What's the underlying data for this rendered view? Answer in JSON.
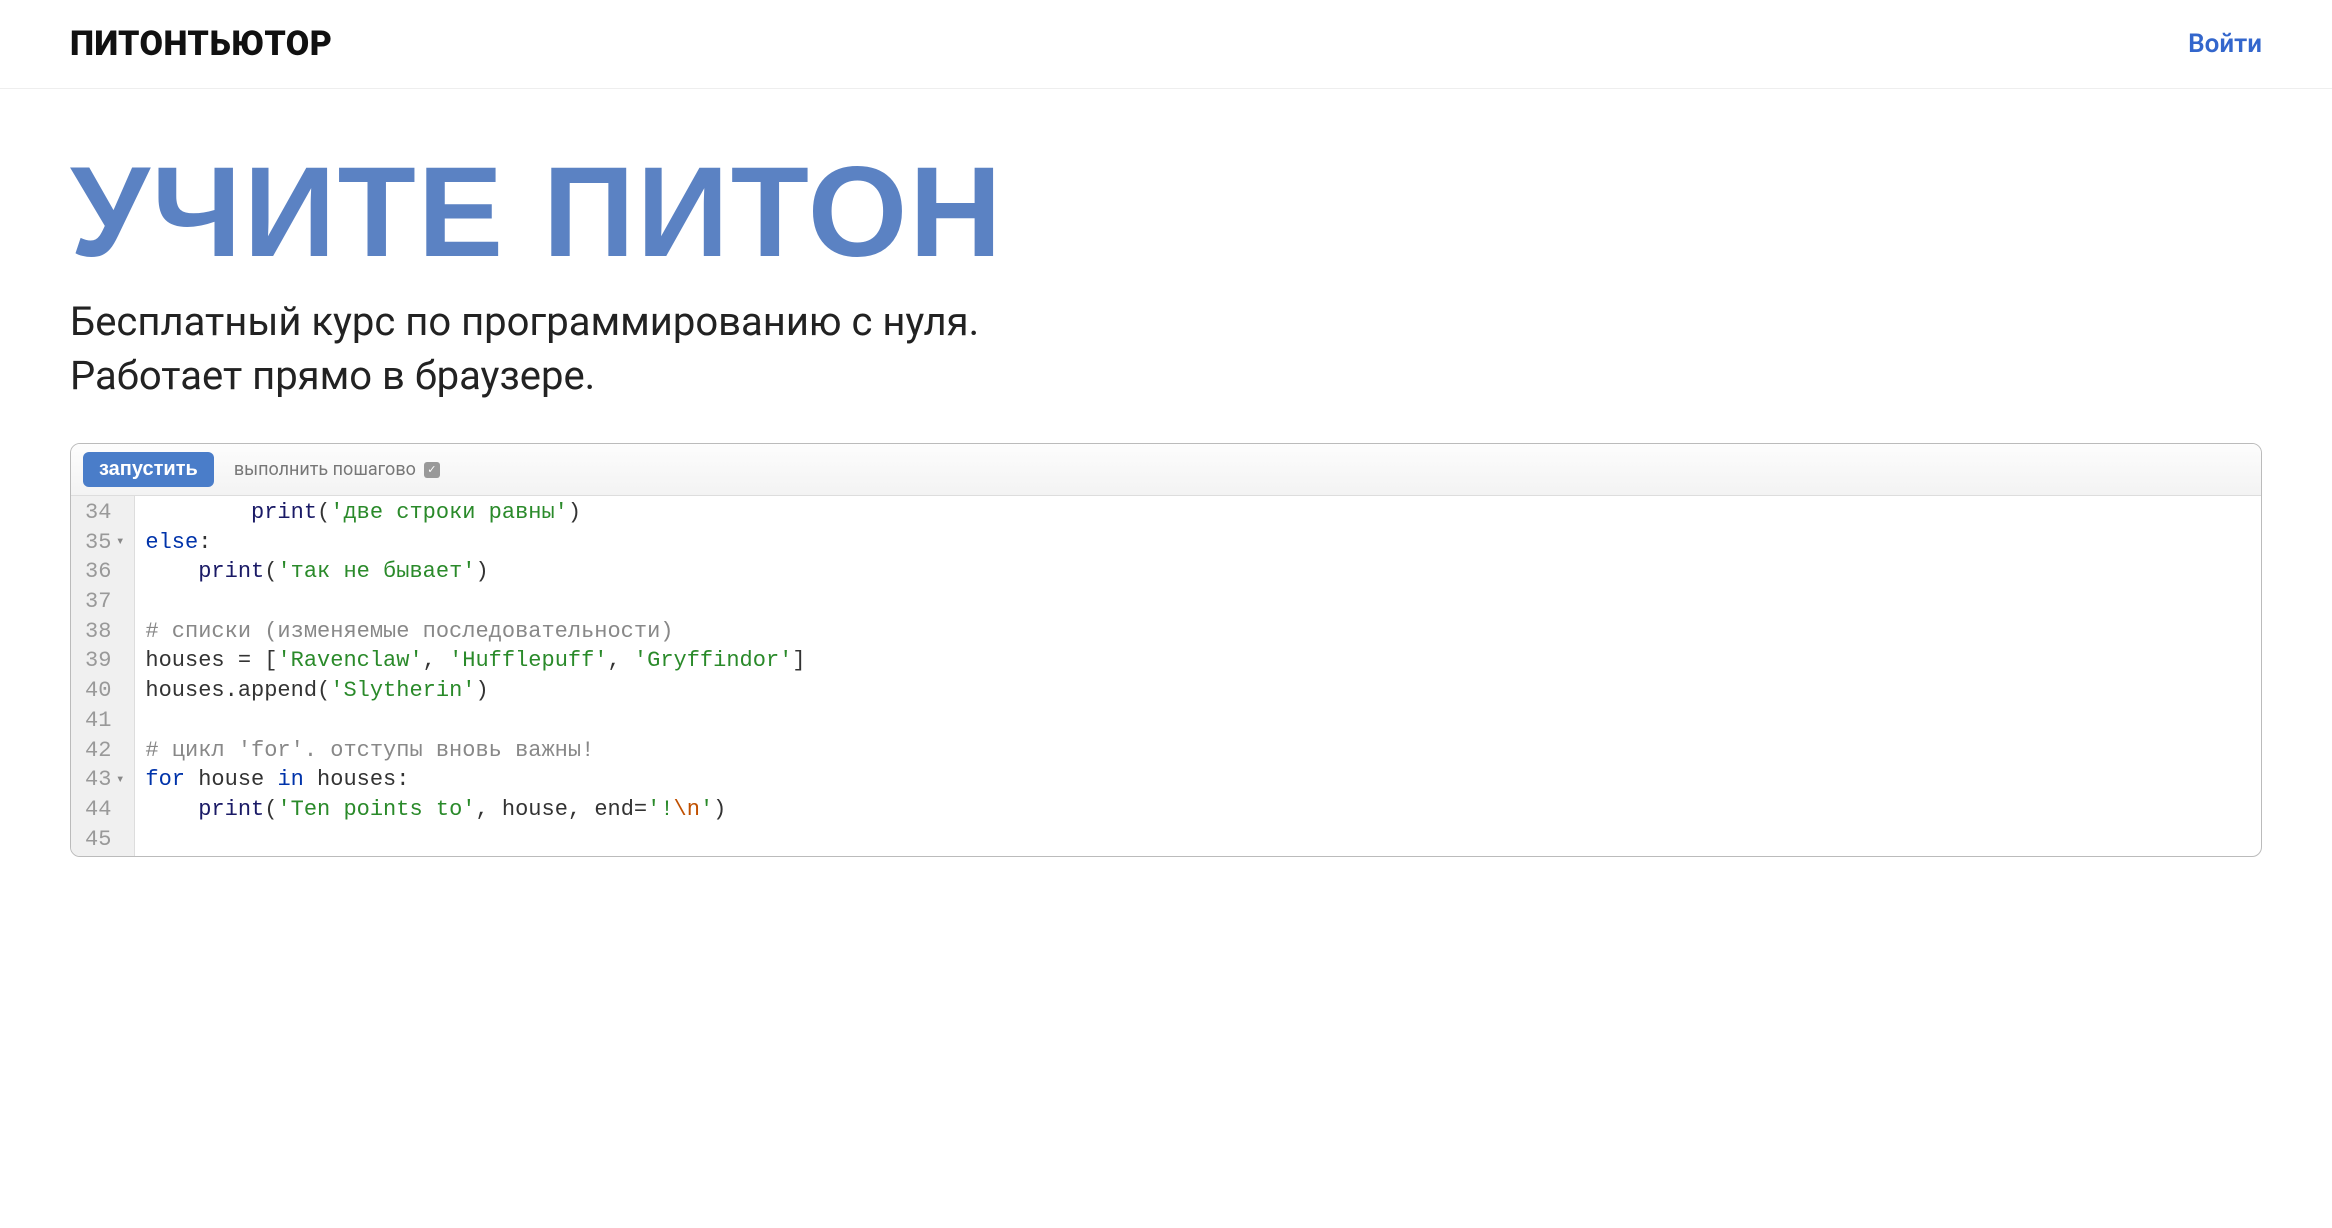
{
  "header": {
    "logo": "ПИТОНТЬЮТОР",
    "login": "Войти"
  },
  "hero": {
    "title": "УЧИТЕ ПИТОН",
    "subtitle_line1": "Бесплатный курс по программированию с нуля.",
    "subtitle_line2": "Работает прямо в браузере."
  },
  "editor": {
    "run_label": "запустить",
    "step_label": "выполнить пошагово",
    "lines": [
      {
        "n": "34",
        "fold": "",
        "tokens": [
          [
            "punct",
            "        "
          ],
          [
            "builtin",
            "print"
          ],
          [
            "punct",
            "("
          ],
          [
            "str",
            "'две строки равны'"
          ],
          [
            "punct",
            ")"
          ]
        ]
      },
      {
        "n": "35",
        "fold": "▾",
        "tokens": [
          [
            "kw",
            "else"
          ],
          [
            "punct",
            ":"
          ]
        ]
      },
      {
        "n": "36",
        "fold": "",
        "tokens": [
          [
            "punct",
            "    "
          ],
          [
            "builtin",
            "print"
          ],
          [
            "punct",
            "("
          ],
          [
            "str",
            "'так не бывает'"
          ],
          [
            "punct",
            ")"
          ]
        ]
      },
      {
        "n": "37",
        "fold": "",
        "tokens": []
      },
      {
        "n": "38",
        "fold": "",
        "tokens": [
          [
            "comment",
            "# списки (изменяемые последовательности)"
          ]
        ]
      },
      {
        "n": "39",
        "fold": "",
        "tokens": [
          [
            "ident",
            "houses"
          ],
          [
            "punct",
            " = ["
          ],
          [
            "str",
            "'Ravenclaw'"
          ],
          [
            "punct",
            ", "
          ],
          [
            "str",
            "'Hufflepuff'"
          ],
          [
            "punct",
            ", "
          ],
          [
            "str",
            "'Gryffindor'"
          ],
          [
            "punct",
            "]"
          ]
        ]
      },
      {
        "n": "40",
        "fold": "",
        "tokens": [
          [
            "ident",
            "houses"
          ],
          [
            "punct",
            "."
          ],
          [
            "ident",
            "append"
          ],
          [
            "punct",
            "("
          ],
          [
            "str",
            "'Slytherin'"
          ],
          [
            "punct",
            ")"
          ]
        ]
      },
      {
        "n": "41",
        "fold": "",
        "tokens": []
      },
      {
        "n": "42",
        "fold": "",
        "tokens": [
          [
            "comment",
            "# цикл 'for'. отступы вновь важны!"
          ]
        ]
      },
      {
        "n": "43",
        "fold": "▾",
        "tokens": [
          [
            "kw",
            "for"
          ],
          [
            "punct",
            " "
          ],
          [
            "ident",
            "house"
          ],
          [
            "punct",
            " "
          ],
          [
            "kw",
            "in"
          ],
          [
            "punct",
            " "
          ],
          [
            "ident",
            "houses"
          ],
          [
            "punct",
            ":"
          ]
        ]
      },
      {
        "n": "44",
        "fold": "",
        "tokens": [
          [
            "punct",
            "    "
          ],
          [
            "builtin",
            "print"
          ],
          [
            "punct",
            "("
          ],
          [
            "str",
            "'Ten points to'"
          ],
          [
            "punct",
            ", "
          ],
          [
            "ident",
            "house"
          ],
          [
            "punct",
            ", "
          ],
          [
            "ident",
            "end"
          ],
          [
            "punct",
            "="
          ],
          [
            "str",
            "'!"
          ],
          [
            "escape",
            "\\n"
          ],
          [
            "str",
            "'"
          ],
          [
            "punct",
            ")"
          ]
        ]
      },
      {
        "n": "45",
        "fold": "",
        "tokens": []
      }
    ]
  }
}
